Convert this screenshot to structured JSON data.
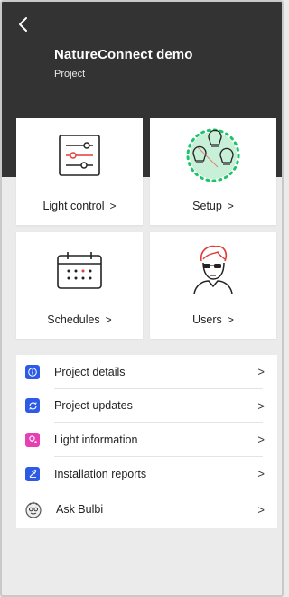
{
  "header": {
    "title": "NatureConnect demo",
    "subtitle": "Project"
  },
  "tiles": [
    {
      "label": "Light control",
      "icon": "sliders-icon"
    },
    {
      "label": "Setup",
      "icon": "bulbs-setup-icon"
    },
    {
      "label": "Schedules",
      "icon": "calendar-icon"
    },
    {
      "label": "Users",
      "icon": "user-avatar-icon"
    }
  ],
  "list": [
    {
      "label": "Project details",
      "icon": "info-icon",
      "color": "#2e5be6"
    },
    {
      "label": "Project updates",
      "icon": "refresh-icon",
      "color": "#2e5be6"
    },
    {
      "label": "Light information",
      "icon": "light-info-icon",
      "color": "#e83fb5"
    },
    {
      "label": "Installation reports",
      "icon": "report-icon",
      "color": "#2e5be6"
    },
    {
      "label": "Ask Bulbi",
      "icon": "bulbi-icon",
      "color": "#555555"
    }
  ],
  "chevron": ">",
  "colors": {
    "header_bg": "#333333",
    "page_bg": "#ebebeb",
    "accent_blue": "#2e5be6",
    "accent_pink": "#e83fb5",
    "setup_green": "#1cc46a",
    "sliders_red": "#e23b3b"
  }
}
